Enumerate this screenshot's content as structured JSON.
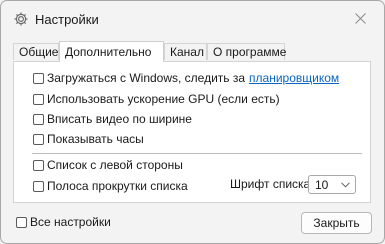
{
  "window": {
    "title": "Настройки",
    "icon": "gear-icon"
  },
  "tabs": [
    {
      "label": "Общие",
      "active": false
    },
    {
      "label": "Дополнительно",
      "active": true
    },
    {
      "label": "Канал",
      "active": false
    },
    {
      "label": "О программе",
      "active": false
    }
  ],
  "options": {
    "autostart": {
      "label": "Загружаться с Windows, следить за",
      "link": "планировщиком",
      "checked": false
    },
    "gpu": {
      "label": "Использовать ускорение GPU (если есть)",
      "checked": false
    },
    "fit_width": {
      "label": "Вписать видео по ширине",
      "checked": false
    },
    "show_clock": {
      "label": "Показывать часы",
      "checked": false
    },
    "list_left": {
      "label": "Список с левой стороны",
      "checked": false
    },
    "list_scrollbar": {
      "label": "Полоса прокрутки списка",
      "checked": false
    }
  },
  "font_size": {
    "label": "Шрифт списка",
    "value": "10"
  },
  "all_settings": {
    "label": "Все настройки",
    "checked": false
  },
  "close_button": {
    "label": "Закрыть"
  },
  "colors": {
    "link": "#0a66c2",
    "background": "#f3f3f3",
    "panel": "#ffffff"
  }
}
